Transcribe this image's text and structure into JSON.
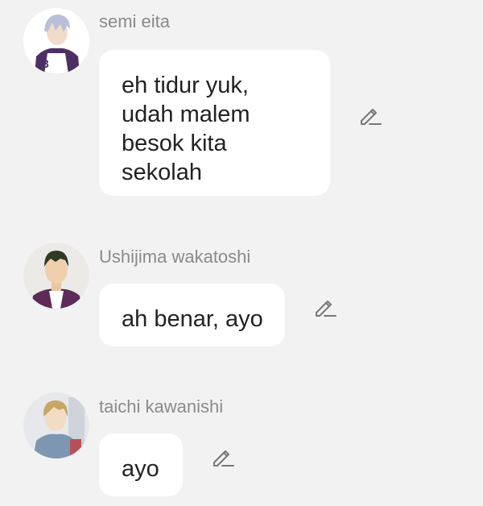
{
  "messages": [
    {
      "sender": "semi eita",
      "lines": [
        "eh tidur yuk,",
        "udah malem",
        "besok kita",
        "sekolah"
      ],
      "avatar_icon": "semi-eita-avatar",
      "edit_icon": "pencil-icon"
    },
    {
      "sender": "Ushijima wakatoshi",
      "lines": [
        "ah benar, ayo"
      ],
      "avatar_icon": "ushijima-wakatoshi-avatar",
      "edit_icon": "pencil-icon"
    },
    {
      "sender": "taichi kawanishi",
      "lines": [
        "ayo"
      ],
      "avatar_icon": "taichi-kawanishi-avatar",
      "edit_icon": "pencil-icon"
    }
  ],
  "colors": {
    "background": "#f2f2f2",
    "bubble": "#ffffff",
    "sender_text": "#8a8a8a",
    "message_text": "#222222",
    "icon": "#777777"
  }
}
